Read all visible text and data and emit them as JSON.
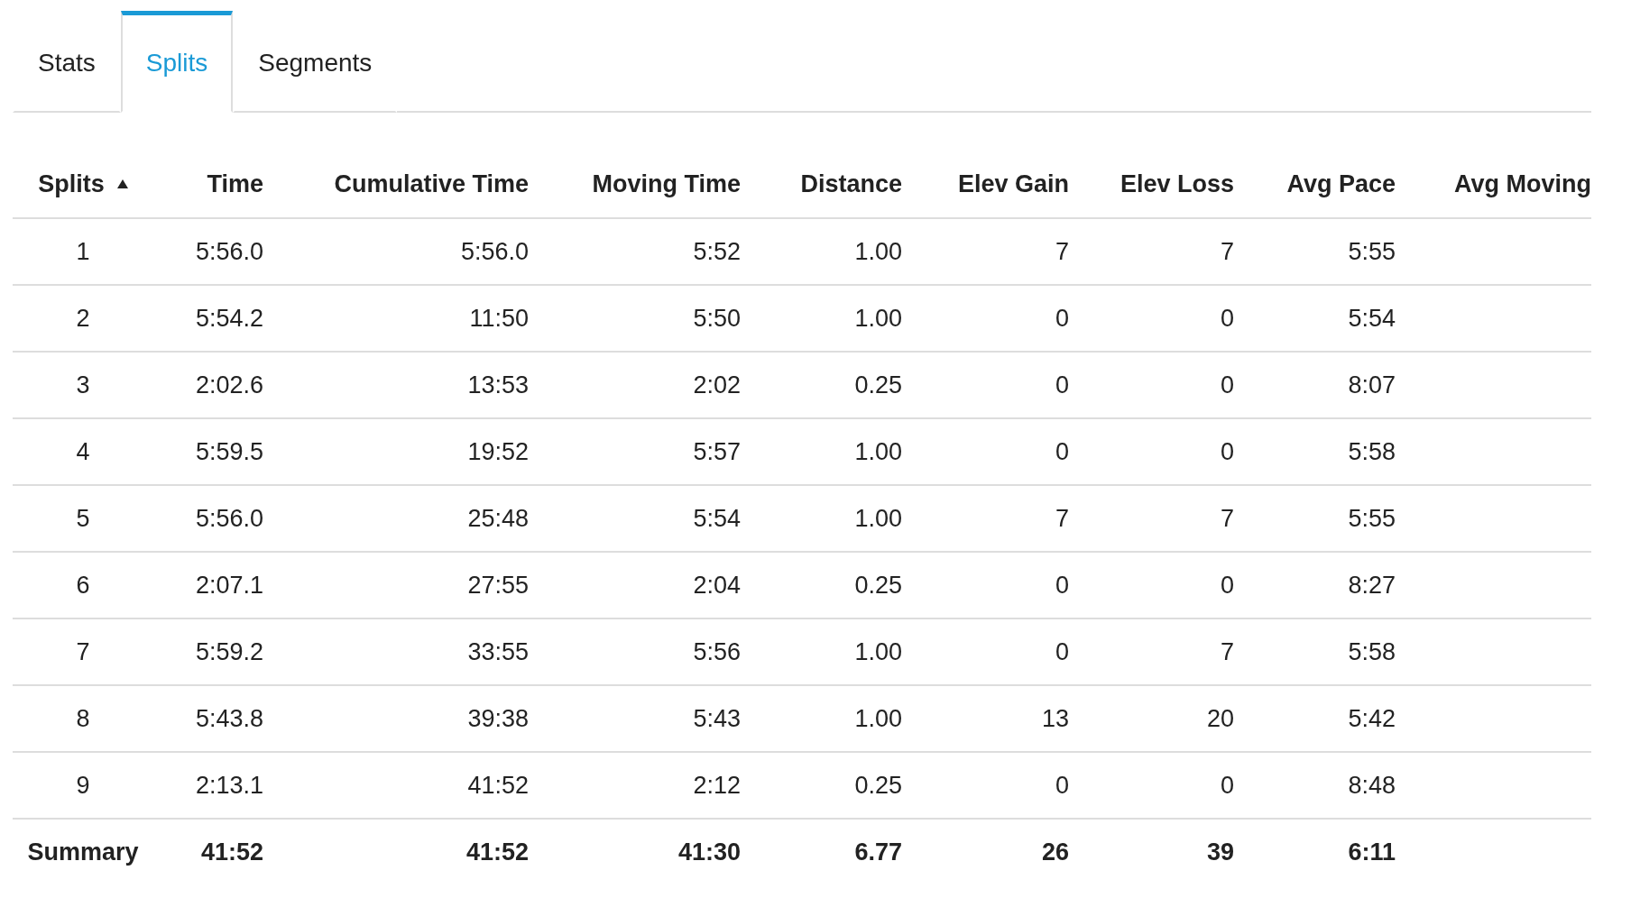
{
  "tabs": [
    {
      "label": "Stats",
      "selected": false
    },
    {
      "label": "Splits",
      "selected": true
    },
    {
      "label": "Segments",
      "selected": false
    }
  ],
  "table": {
    "columns": [
      {
        "label": "Splits",
        "sorted": true
      },
      {
        "label": "Time",
        "sorted": false
      },
      {
        "label": "Cumulative Time",
        "sorted": false
      },
      {
        "label": "Moving Time",
        "sorted": false
      },
      {
        "label": "Distance",
        "sorted": false
      },
      {
        "label": "Elev Gain",
        "sorted": false
      },
      {
        "label": "Elev Loss",
        "sorted": false
      },
      {
        "label": "Avg Pace",
        "sorted": false
      },
      {
        "label": "Avg Moving",
        "sorted": false
      }
    ],
    "rows": [
      [
        "1",
        "5:56.0",
        "5:56.0",
        "5:52",
        "1.00",
        "7",
        "7",
        "5:55"
      ],
      [
        "2",
        "5:54.2",
        "11:50",
        "5:50",
        "1.00",
        "0",
        "0",
        "5:54"
      ],
      [
        "3",
        "2:02.6",
        "13:53",
        "2:02",
        "0.25",
        "0",
        "0",
        "8:07"
      ],
      [
        "4",
        "5:59.5",
        "19:52",
        "5:57",
        "1.00",
        "0",
        "0",
        "5:58"
      ],
      [
        "5",
        "5:56.0",
        "25:48",
        "5:54",
        "1.00",
        "7",
        "7",
        "5:55"
      ],
      [
        "6",
        "2:07.1",
        "27:55",
        "2:04",
        "0.25",
        "0",
        "0",
        "8:27"
      ],
      [
        "7",
        "5:59.2",
        "33:55",
        "5:56",
        "1.00",
        "0",
        "7",
        "5:58"
      ],
      [
        "8",
        "5:43.8",
        "39:38",
        "5:43",
        "1.00",
        "13",
        "20",
        "5:42"
      ],
      [
        "9",
        "2:13.1",
        "41:52",
        "2:12",
        "0.25",
        "0",
        "0",
        "8:48"
      ]
    ],
    "summary": [
      "Summary",
      "41:52",
      "41:52",
      "41:30",
      "6.77",
      "26",
      "39",
      "6:11"
    ]
  }
}
